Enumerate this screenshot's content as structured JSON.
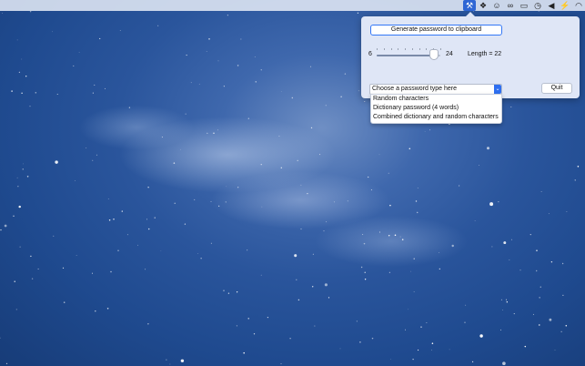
{
  "menubar": {
    "icons": [
      {
        "name": "tools-icon",
        "glyph": "⚒",
        "active": true
      },
      {
        "name": "dropbox-icon",
        "glyph": "❖",
        "active": false
      },
      {
        "name": "bear-icon",
        "glyph": "☺",
        "active": false
      },
      {
        "name": "creative-cloud-icon",
        "glyph": "∞",
        "active": false
      },
      {
        "name": "cast-icon",
        "glyph": "▭",
        "active": false
      },
      {
        "name": "time-machine-icon",
        "glyph": "◷",
        "active": false
      },
      {
        "name": "volume-icon",
        "glyph": "◀",
        "active": false
      },
      {
        "name": "battery-bolt-icon",
        "glyph": "⚡",
        "active": false
      },
      {
        "name": "wifi-icon",
        "glyph": "◠",
        "active": false
      }
    ]
  },
  "panel": {
    "generate_label": "Generate password to clipboard",
    "slider": {
      "min_label": "6",
      "max_label": "24",
      "min": 6,
      "max": 24,
      "value": 22,
      "tick_count": 10
    },
    "length_label": "Length = 22",
    "select": {
      "placeholder": "Choose a password type here",
      "arrow_glyph": "⌄"
    },
    "quit_label": "Quit",
    "dropdown_options": [
      "Random characters",
      "Dictionary password (4 words)",
      "Combined dictionary and random characters"
    ]
  }
}
